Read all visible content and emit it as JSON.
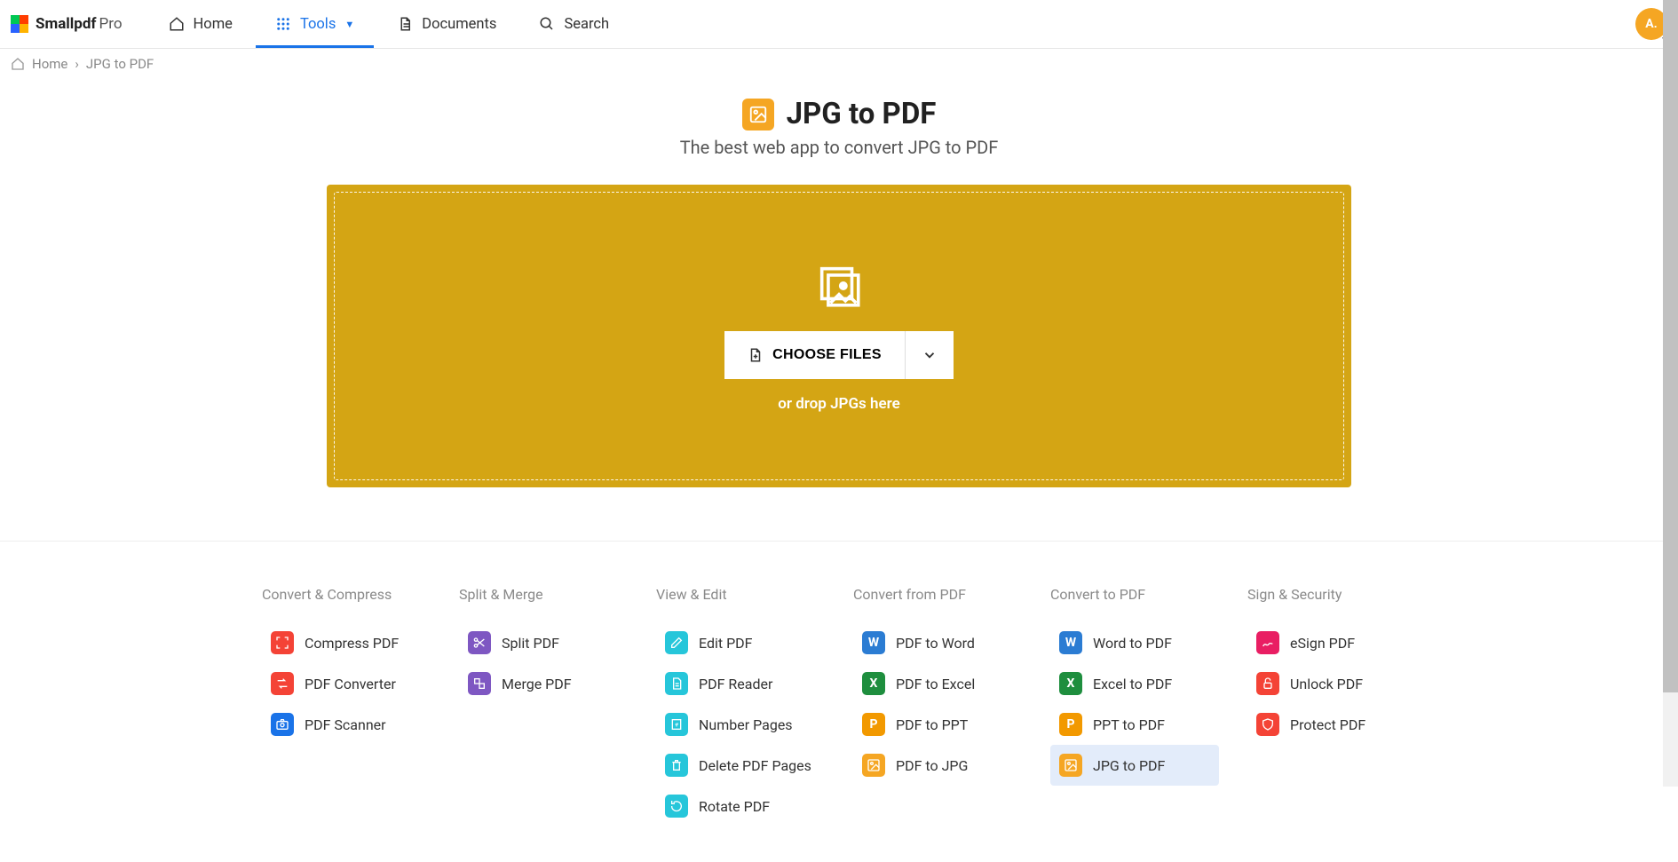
{
  "brand": {
    "name": "Smallpdf",
    "tier": "Pro"
  },
  "nav": {
    "home": "Home",
    "tools": "Tools",
    "documents": "Documents",
    "search": "Search"
  },
  "avatar": {
    "initials": "A."
  },
  "breadcrumb": {
    "home": "Home",
    "sep": "›",
    "current": "JPG to PDF"
  },
  "hero": {
    "title": "JPG to PDF",
    "subtitle": "The best web app to convert JPG to PDF",
    "choose": "CHOOSE FILES",
    "drop_hint": "or drop JPGs here"
  },
  "tools": {
    "col1_title": "Convert & Compress",
    "compress": "Compress PDF",
    "converter": "PDF Converter",
    "scanner": "PDF Scanner",
    "col2_title": "Split & Merge",
    "split": "Split PDF",
    "merge": "Merge PDF",
    "col3_title": "View & Edit",
    "edit": "Edit PDF",
    "reader": "PDF Reader",
    "number": "Number Pages",
    "delete": "Delete PDF Pages",
    "rotate": "Rotate PDF",
    "col4_title": "Convert from PDF",
    "toword": "PDF to Word",
    "toexcel": "PDF to Excel",
    "toppt": "PDF to PPT",
    "tojpg": "PDF to JPG",
    "col5_title": "Convert to PDF",
    "wordto": "Word to PDF",
    "excelto": "Excel to PDF",
    "pptto": "PPT to PDF",
    "jpgto": "JPG to PDF",
    "col6_title": "Sign & Security",
    "esign": "eSign PDF",
    "unlock": "Unlock PDF",
    "protect": "Protect PDF"
  }
}
